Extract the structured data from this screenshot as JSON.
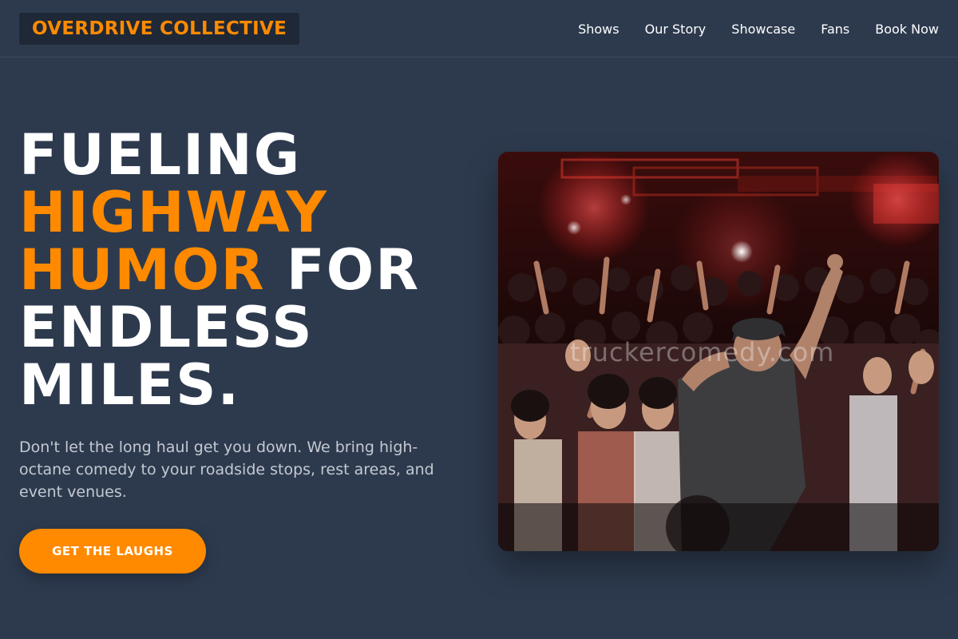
{
  "header": {
    "brand": "OVERDRIVE COLLECTIVE",
    "nav": [
      {
        "label": "Shows"
      },
      {
        "label": "Our Story"
      },
      {
        "label": "Showcase"
      },
      {
        "label": "Fans"
      },
      {
        "label": "Book Now"
      }
    ]
  },
  "hero": {
    "title_part1": "FUELING",
    "title_highlight_1": "HIGHWAY",
    "title_highlight_2": "HUMOR",
    "title_part2": "FOR",
    "title_part3": "ENDLESS",
    "title_part4": "MILES.",
    "description": "Don't let the long haul get you down. We bring high-octane comedy to your roadside stops, rest areas, and event venues.",
    "cta_label": "GET THE LAUGHS",
    "image_watermark": "truckercomedy.com"
  },
  "colors": {
    "background": "#2d3a4e",
    "accent": "#ff8a00",
    "brand_background": "#1f2836",
    "text": "#ffffff",
    "muted_text": "#c4c9d1"
  }
}
